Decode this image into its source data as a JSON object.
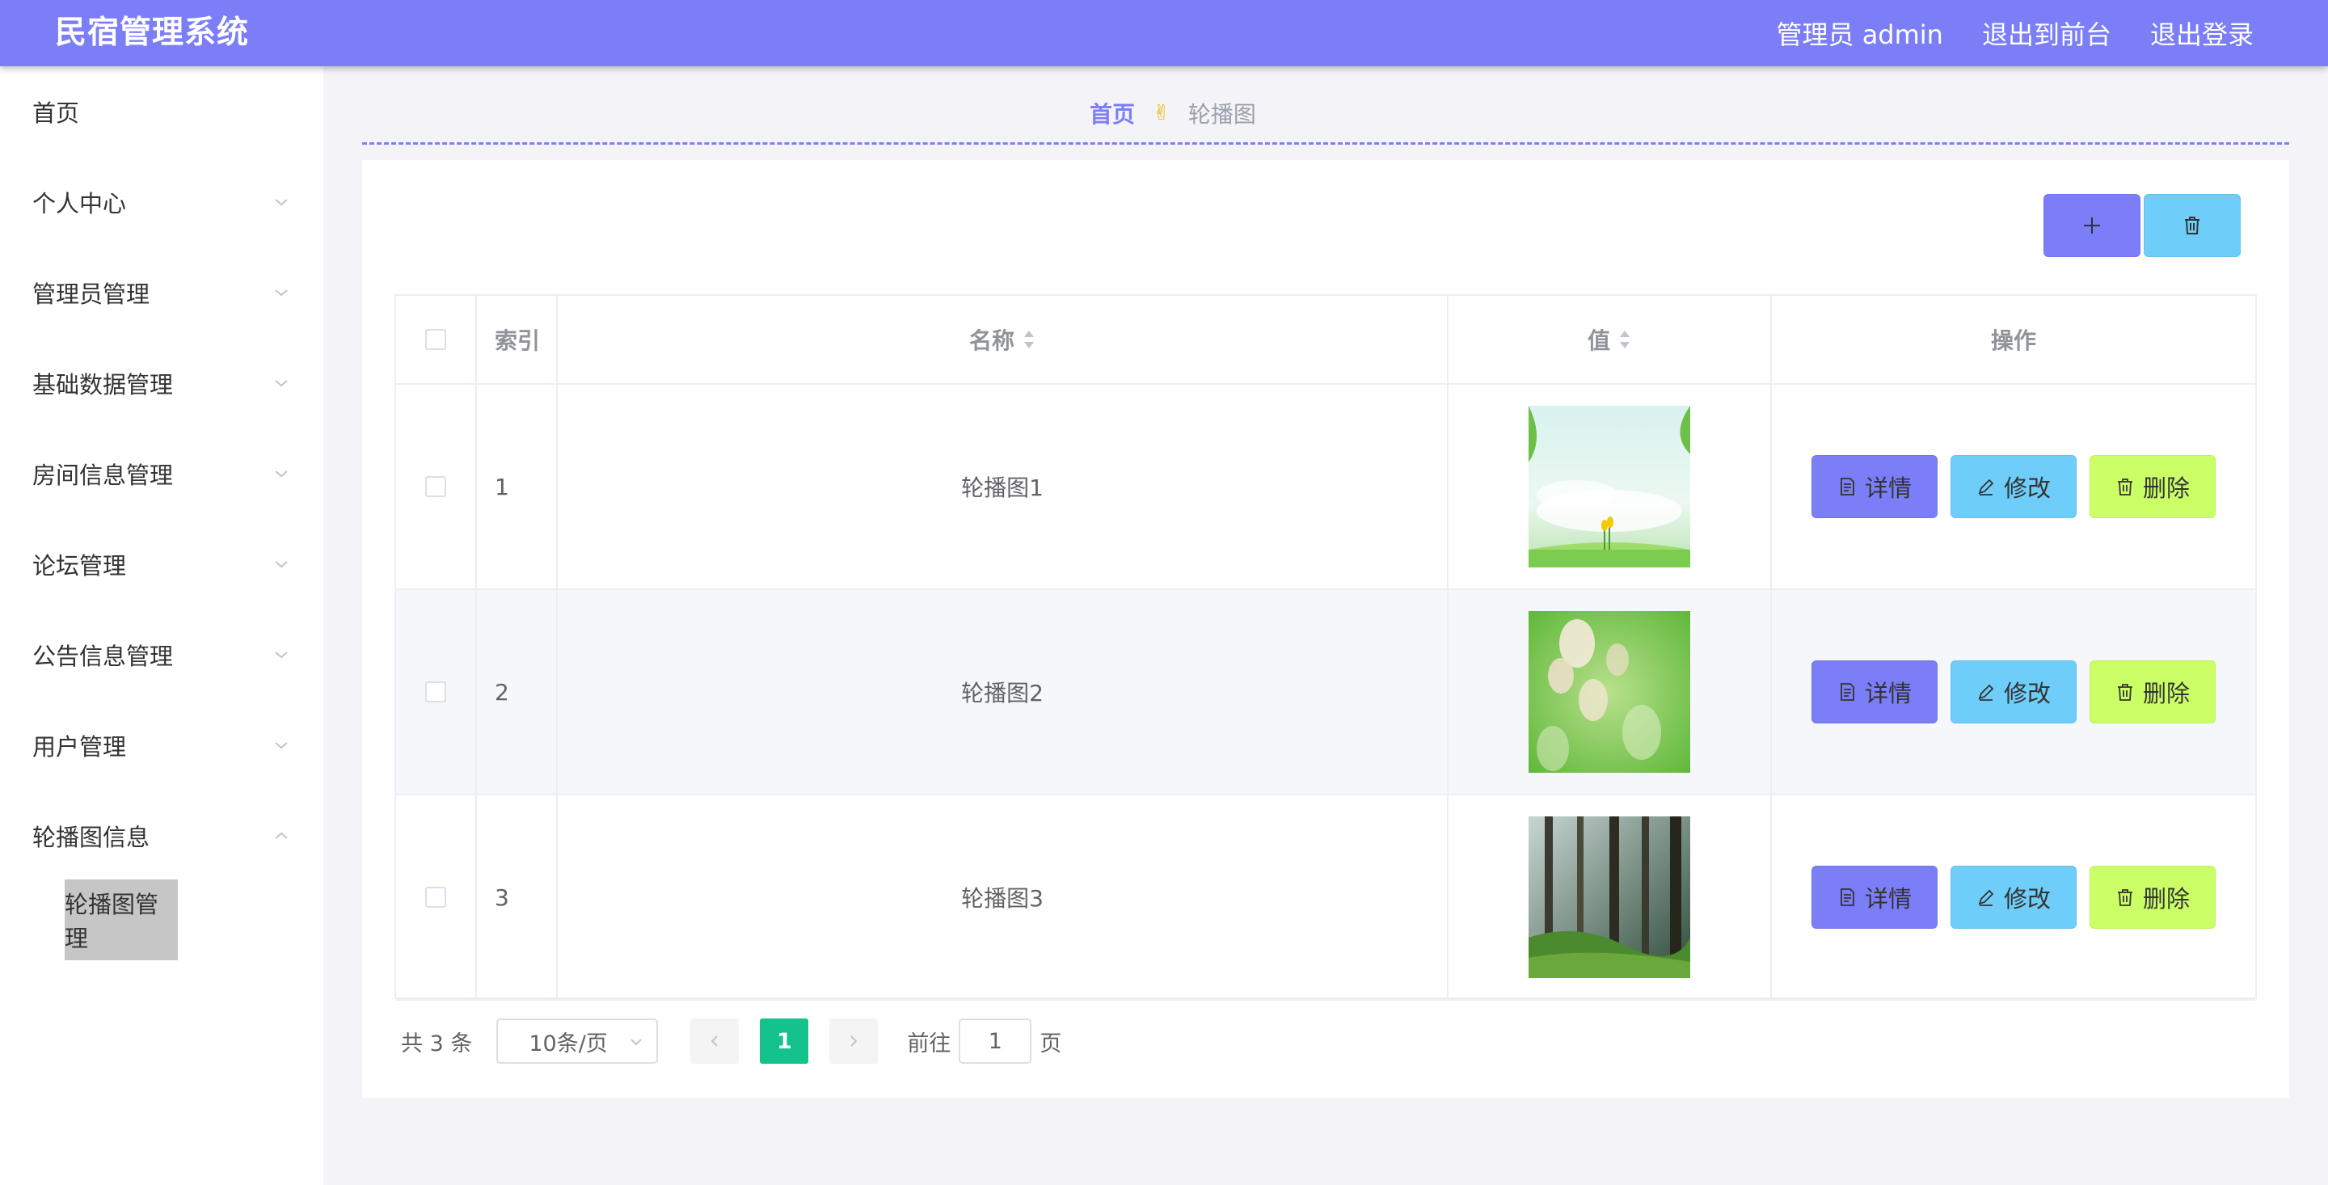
{
  "header": {
    "brand": "民宿管理系统",
    "admin_label": "管理员 admin",
    "to_front": "退出到前台",
    "logout": "退出登录",
    "bg_color": "#7b7ef7"
  },
  "sidebar": {
    "items": [
      {
        "label": "首页",
        "has_chevron": false
      },
      {
        "label": "个人中心",
        "has_chevron": true
      },
      {
        "label": "管理员管理",
        "has_chevron": true
      },
      {
        "label": "基础数据管理",
        "has_chevron": true
      },
      {
        "label": "房间信息管理",
        "has_chevron": true
      },
      {
        "label": "论坛管理",
        "has_chevron": true
      },
      {
        "label": "公告信息管理",
        "has_chevron": true
      },
      {
        "label": "用户管理",
        "has_chevron": true
      },
      {
        "label": "轮播图信息",
        "has_chevron": true,
        "expanded": true
      }
    ],
    "active_sub": "轮播图管理"
  },
  "breadcrumb": {
    "home": "首页",
    "current": "轮播图"
  },
  "toolbar": {
    "add_icon": "plus-icon",
    "delete_icon": "trash-icon"
  },
  "table": {
    "headers": {
      "index": "索引",
      "name": "名称",
      "value": "值",
      "ops": "操作"
    },
    "rows": [
      {
        "index": "1",
        "name": "轮播图1",
        "image": "sky-grass-thumbnail"
      },
      {
        "index": "2",
        "name": "轮播图2",
        "image": "blurred-flowers-thumbnail"
      },
      {
        "index": "3",
        "name": "轮播图3",
        "image": "forest-thumbnail"
      }
    ],
    "row_actions": {
      "detail": "详情",
      "edit": "修改",
      "delete": "删除"
    }
  },
  "pagination": {
    "total": "共 3 条",
    "page_size": "10条/页",
    "current_page": "1",
    "goto_label": "前往",
    "goto_value": "1",
    "goto_suffix": "页"
  },
  "colors": {
    "primary": "#7b7ef7",
    "info": "#6fcdfa",
    "warn": "#cbff66",
    "page_active": "#13c28d"
  }
}
